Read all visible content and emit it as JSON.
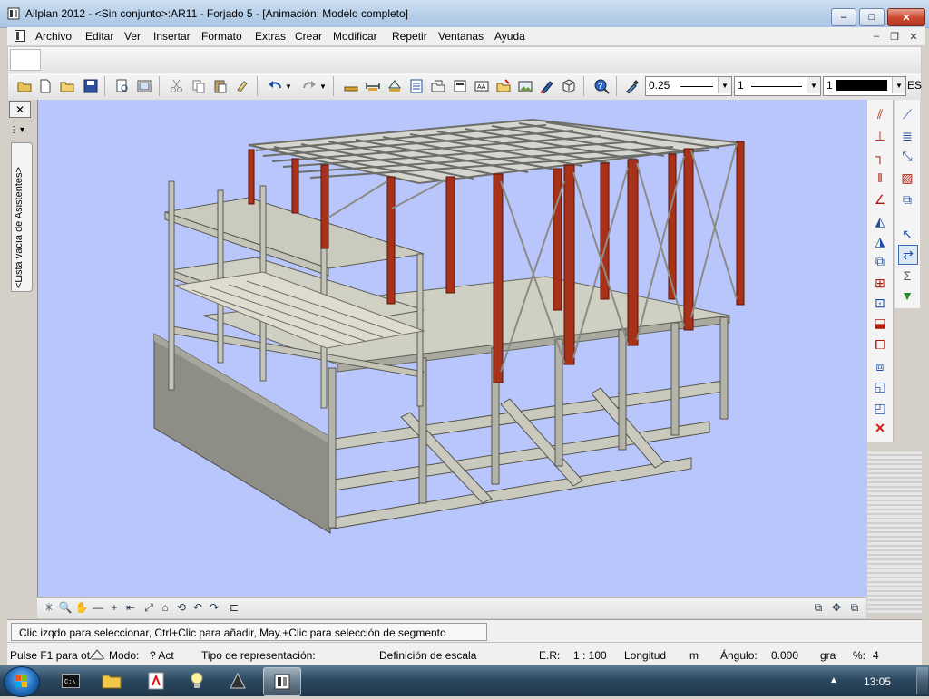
{
  "window": {
    "title": "Allplan 2012 - <Sin conjunto>:AR11 - Forjado 5 - [Animación: Modelo completo]",
    "minimize": "–",
    "maximize": "□",
    "close": "✕"
  },
  "menu": {
    "items": [
      "Archivo",
      "Editar",
      "Ver",
      "Insertar",
      "Formato",
      "Extras",
      "Crear",
      "Modificar",
      "Repetir",
      "Ventanas",
      "Ayuda"
    ],
    "mdi_min": "–",
    "mdi_restore": "❐",
    "mdi_close": "✕"
  },
  "toolbar": {
    "pen_thickness": "0.25",
    "line_type": "1",
    "color": "1",
    "overflow_label": "ES"
  },
  "left_panel": {
    "close": "✕",
    "arrow": "▾",
    "assistants_tab": "<Lista vacía de Asistentes>"
  },
  "message": "Clic izqdo para seleccionar, Ctrl+Clic para añadir, May.+Clic para selección de segmento",
  "status": {
    "help": "Pulse F1 para ot",
    "mode_label": "Modo:",
    "mode_value": "? Act",
    "representation": "Tipo de representación:",
    "scale_def": "Definición de escala",
    "er_label": "E.R:",
    "er_value": "1 : 100",
    "length_label": "Longitud",
    "length_unit": "m",
    "angle_label": "Ángulo:",
    "angle_value": "0.000",
    "angle_unit": "gra",
    "percent_label": "%:",
    "percent_value": "4"
  },
  "taskbar": {
    "clock": "13:05",
    "tray_arrow": "▲"
  },
  "colors": {
    "viewport_bg": "#b9c6fb",
    "steel_red": "#a8311a",
    "concrete": "#c8c8bd"
  }
}
